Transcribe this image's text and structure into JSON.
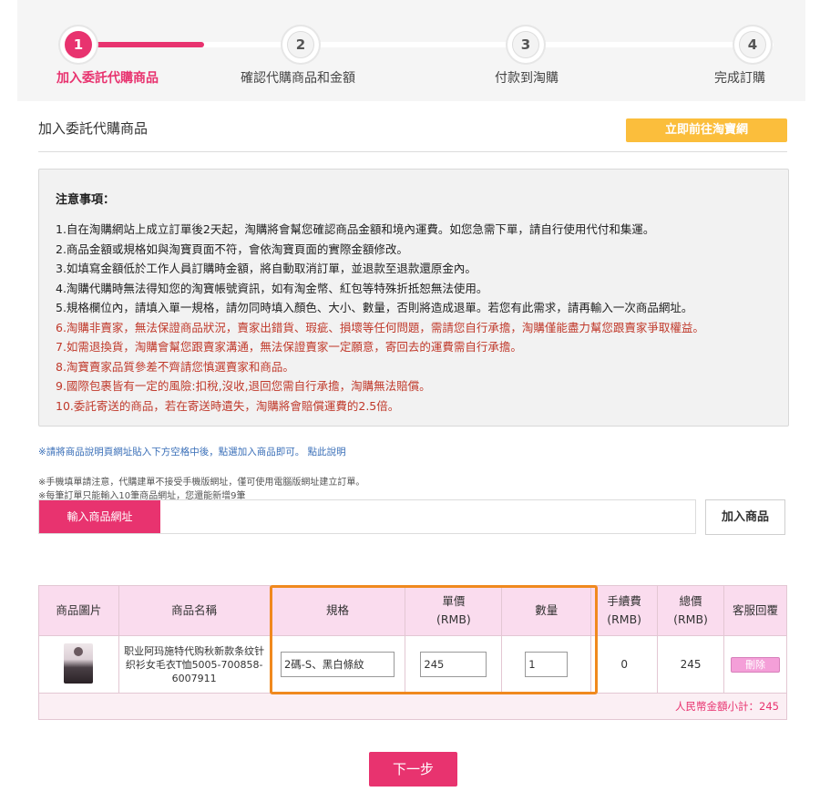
{
  "progress": {
    "steps": [
      {
        "num": "1",
        "label": "加入委託代購商品"
      },
      {
        "num": "2",
        "label": "確認代購商品和金額"
      },
      {
        "num": "3",
        "label": "付款到淘購"
      },
      {
        "num": "4",
        "label": "完成訂購"
      }
    ],
    "accent_color": "#e8336f"
  },
  "section": {
    "title": "加入委託代購商品",
    "go_button": "立即前往淘寶網"
  },
  "notice": {
    "title": "注意事項：",
    "lines": [
      "1.自在淘購網站上成立訂單後2天起，淘購將會幫您確認商品金額和境內運費。如您急需下單，請自行使用代付和集運。",
      "2.商品金額或規格如與淘寶頁面不符，會依淘寶頁面的實際金額修改。",
      "3.如填寫金額低於工作人員訂購時金額，將自動取消訂單，並退款至退款還原金內。",
      "4.淘購代購時無法得知您的淘寶帳號資訊，如有淘金幣、紅包等特殊折抵恕無法使用。",
      "5.規格欄位內，請填入單一規格，請勿同時填入顏色、大小、數量，否則將造成退單。若您有此需求，請再輸入一次商品網址。"
    ],
    "red_lines": [
      "6.淘購非賣家，無法保證商品狀況，賣家出錯貨、瑕疵、損壞等任何問題，需請您自行承擔，淘購僅能盡力幫您跟賣家爭取權益。",
      "7.如需退換貨，淘購會幫您跟賣家溝通，無法保證賣家一定願意，寄回去的運費需自行承擔。",
      "8.淘寶賣家品質參差不齊請您慎選賣家和商品。",
      "9.國際包裹皆有一定的風險:扣稅,沒收,退回您需自行承擔，淘購無法賠償。",
      "10.委託寄送的商品，若在寄送時遺失，淘購將會賠償運費的2.5倍。"
    ]
  },
  "hints": {
    "link": "※請將商品說明頁網址貼入下方空格中後，點選加入商品即可。 點此說明",
    "mobile": "※手機填單請注意，代購建單不接受手機版網址，僅可使用電腦版網址建立訂單。",
    "limit": "※每筆訂單只能輸入10筆商品網址，您還能新增9筆"
  },
  "url_entry": {
    "label": "輸入商品網址",
    "value": "",
    "add_button": "加入商品"
  },
  "table": {
    "headers": {
      "image": "商品圖片",
      "name": "商品名稱",
      "spec": "規格",
      "price": "單價",
      "price_unit": "(RMB)",
      "qty": "數量",
      "fee": "手續費",
      "fee_unit": "(RMB)",
      "total": "總價",
      "total_unit": "(RMB)",
      "service": "客服回覆"
    },
    "row": {
      "name": "职业阿玛施特代购秋新款条纹针织衫女毛衣T恤5005-700858-6007911",
      "spec": "2碼-S、黑白條紋",
      "price": "245",
      "qty": "1",
      "fee": "0",
      "total": "245",
      "delete": "刪除"
    },
    "subtotal": "人民幣金額小計：245"
  },
  "next_button": "下一步"
}
